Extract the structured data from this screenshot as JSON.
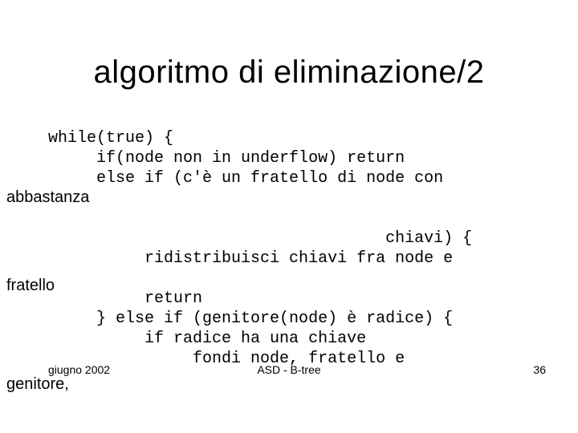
{
  "title": "algoritmo di eliminazione/2",
  "code": {
    "line1": "     while(true) {",
    "line2": "          if(node non in underflow) return",
    "line3": "          else if (c'è un fratello di node con",
    "line4": "",
    "line5": "",
    "line6": "                                        chiavi) {",
    "line7": "               ridistribuisci chiavi fra node e",
    "line8": "",
    "line9": "               return",
    "line10": "          } else if (genitore(node) è radice) {",
    "line11": "               if radice ha una chiave",
    "line12": "                    fondi node, fratello e"
  },
  "annotations": {
    "abbastanza": "abbastanza",
    "fratello": "fratello",
    "genitore": "genitore,"
  },
  "footer": {
    "date": "giugno 2002",
    "center": "ASD - B-tree",
    "page": "36"
  }
}
